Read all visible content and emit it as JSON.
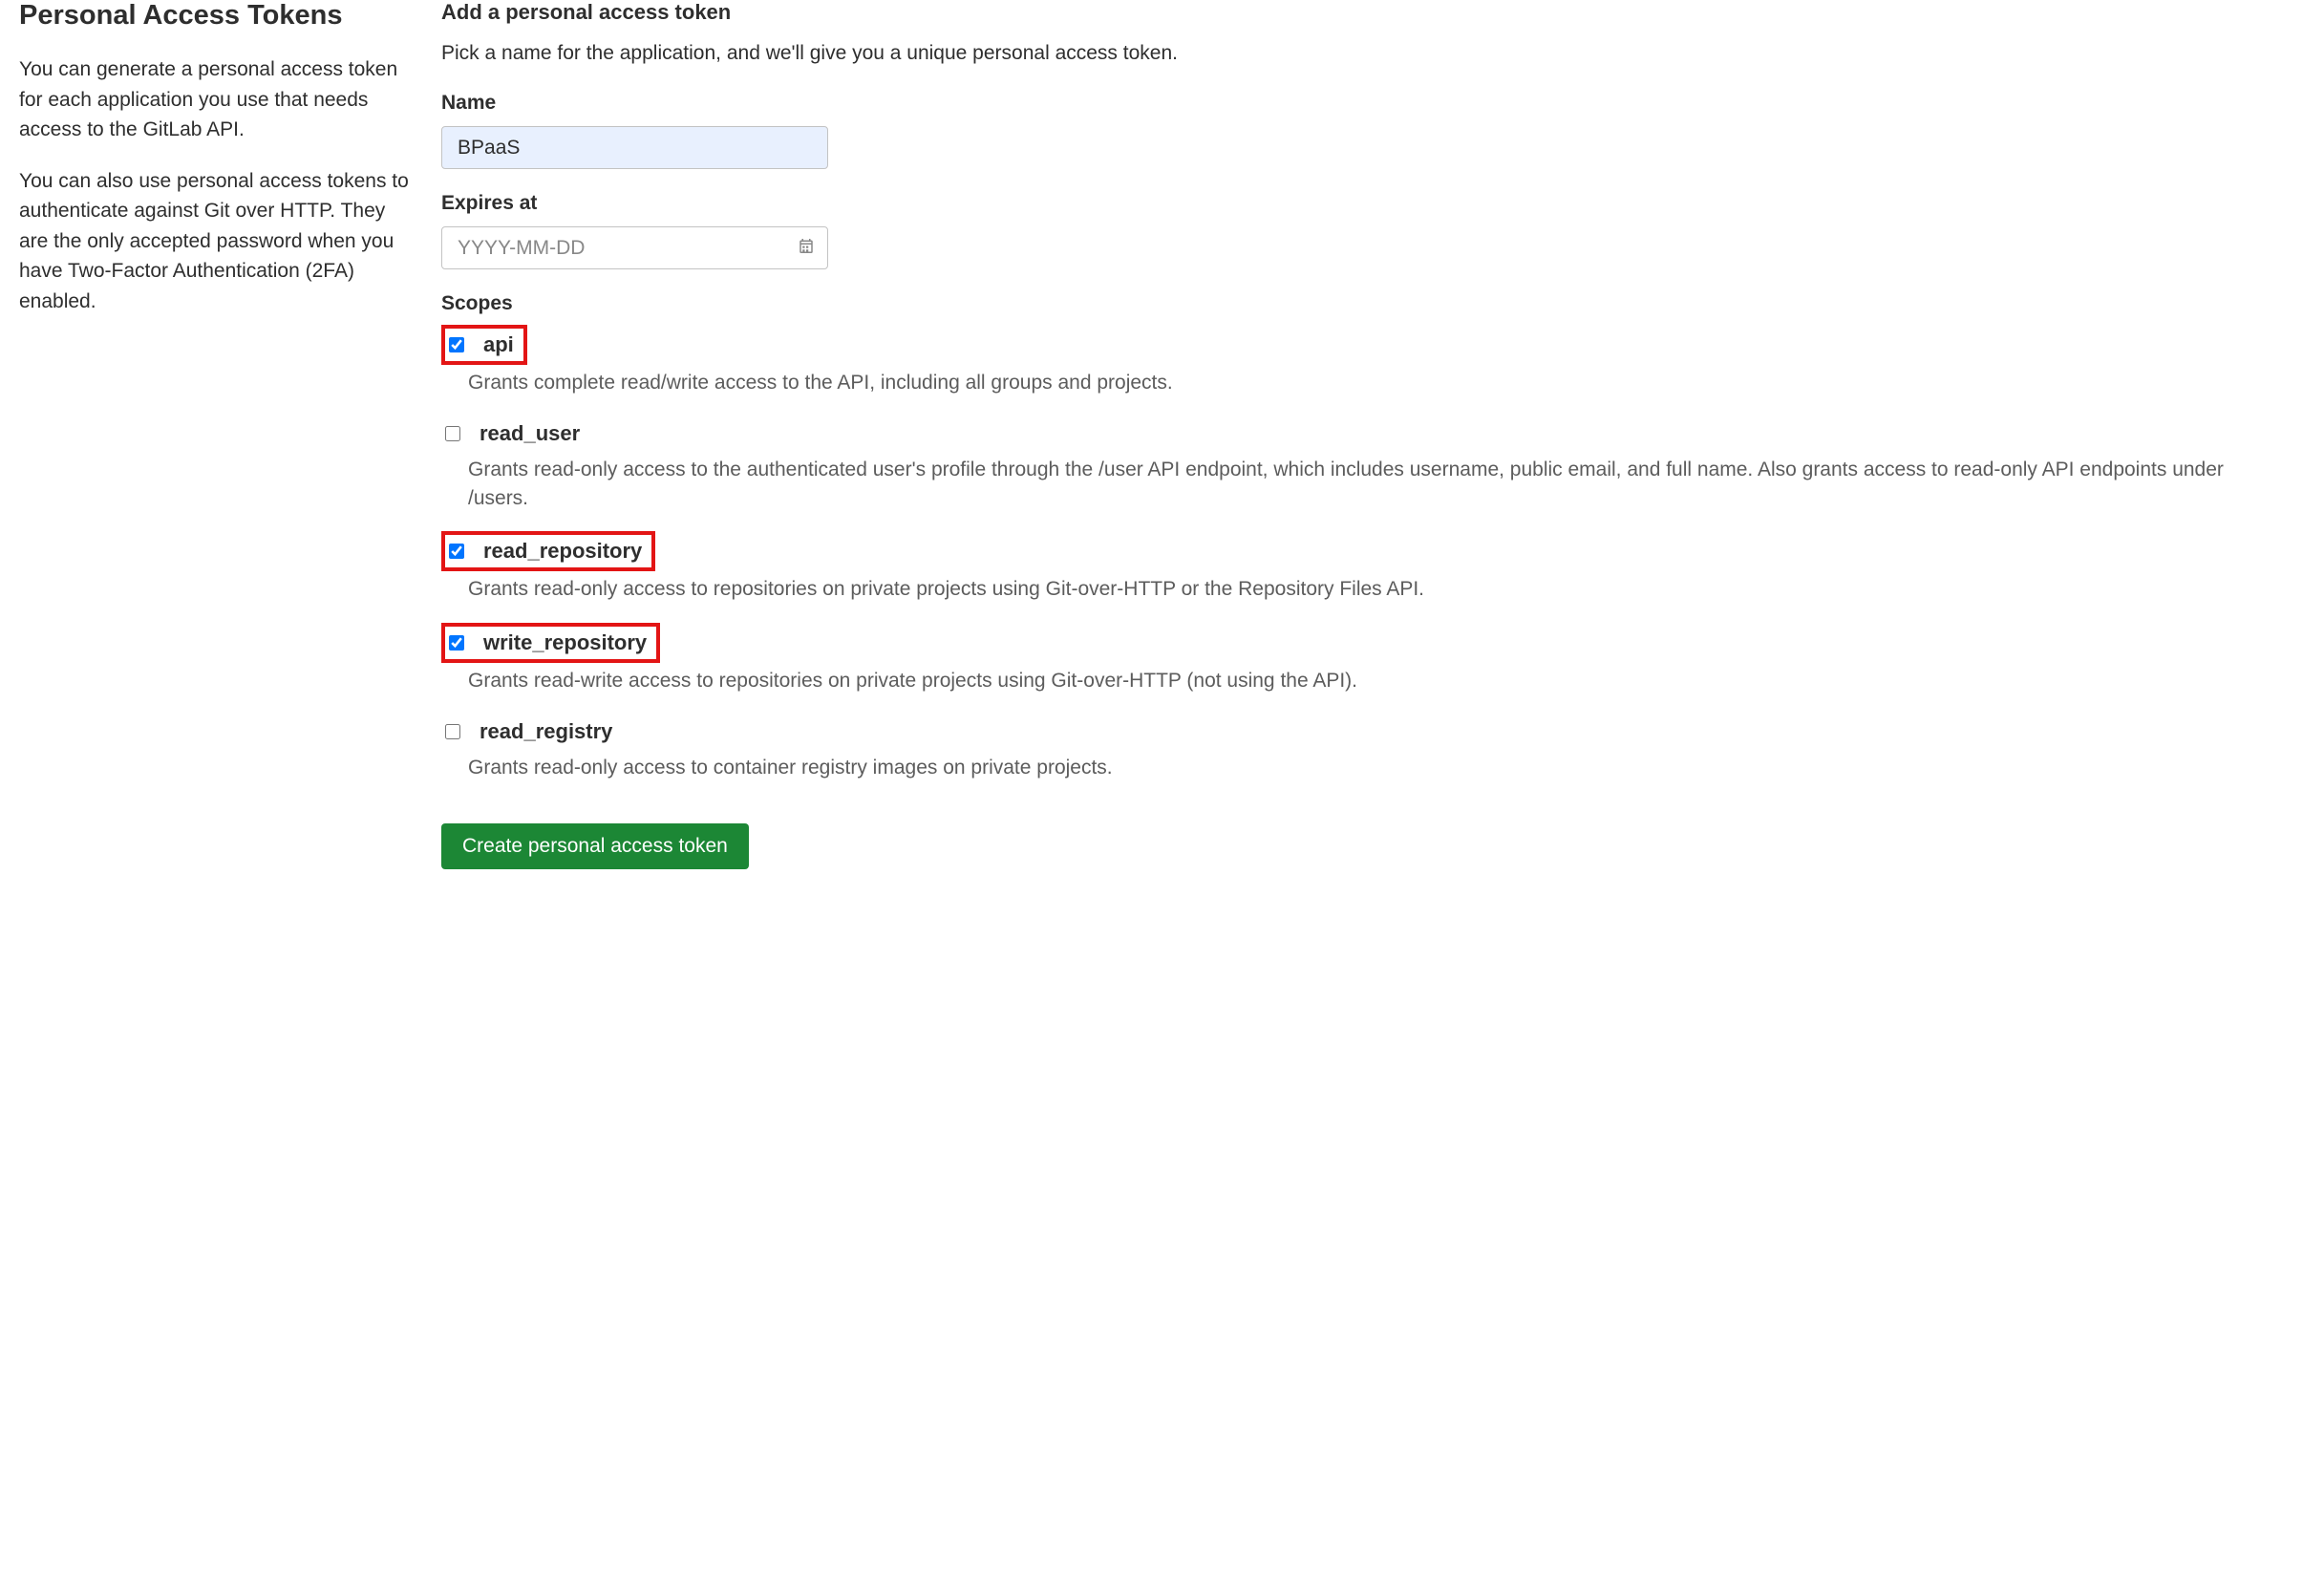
{
  "left": {
    "title": "Personal Access Tokens",
    "desc1": "You can generate a personal access token for each application you use that needs access to the GitLab API.",
    "desc2": "You can also use personal access tokens to authenticate against Git over HTTP. They are the only accepted password when you have Two-Factor Authentication (2FA) enabled."
  },
  "form": {
    "heading": "Add a personal access token",
    "subheading": "Pick a name for the application, and we'll give you a unique personal access token.",
    "name_label": "Name",
    "name_value": "BPaaS",
    "expires_label": "Expires at",
    "expires_placeholder": "YYYY-MM-DD",
    "expires_value": "",
    "scopes_label": "Scopes",
    "scopes": [
      {
        "key": "api",
        "label": "api",
        "desc": "Grants complete read/write access to the API, including all groups and projects.",
        "checked": true,
        "highlighted": true
      },
      {
        "key": "read_user",
        "label": "read_user",
        "desc": "Grants read-only access to the authenticated user's profile through the /user API endpoint, which includes username, public email, and full name. Also grants access to read-only API endpoints under /users.",
        "checked": false,
        "highlighted": false
      },
      {
        "key": "read_repository",
        "label": "read_repository",
        "desc": "Grants read-only access to repositories on private projects using Git-over-HTTP or the Repository Files API.",
        "checked": true,
        "highlighted": true
      },
      {
        "key": "write_repository",
        "label": "write_repository",
        "desc": "Grants read-write access to repositories on private projects using Git-over-HTTP (not using the API).",
        "checked": true,
        "highlighted": true
      },
      {
        "key": "read_registry",
        "label": "read_registry",
        "desc": "Grants read-only access to container registry images on private projects.",
        "checked": false,
        "highlighted": false
      }
    ],
    "submit_label": "Create personal access token"
  }
}
